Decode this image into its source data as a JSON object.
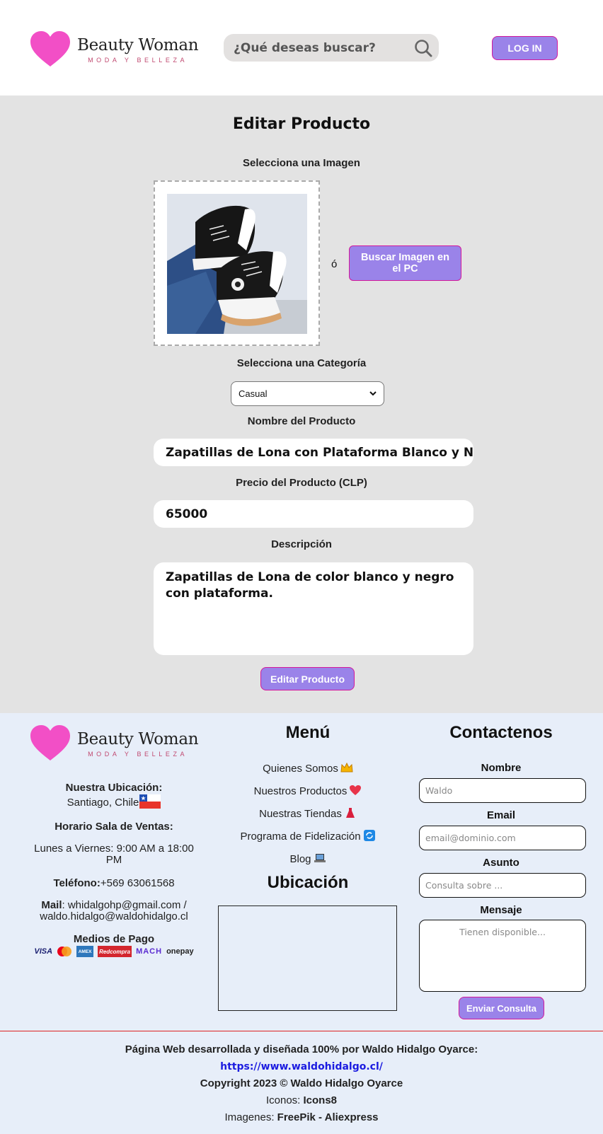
{
  "header": {
    "brand_name": "Beauty Woman",
    "brand_tagline": "MODA Y BELLEZA",
    "search_placeholder": "¿Qué deseas buscar?",
    "login_label": "LOG IN"
  },
  "main": {
    "title": "Editar Producto",
    "image_label": "Selecciona una Imagen",
    "or_text": "ó",
    "browse_label": "Buscar Imagen en el PC",
    "category_label": "Selecciona una Categoría",
    "category_value": "Casual",
    "name_label": "Nombre del Producto",
    "name_value": "Zapatillas de Lona con Plataforma Blanco y Negro",
    "price_label": "Precio del Producto (CLP)",
    "price_value": "65000",
    "description_label": "Descripción",
    "description_value": "Zapatillas de Lona de color blanco y negro con plataforma.",
    "submit_label": "Editar Producto"
  },
  "footer": {
    "brand_name": "Beauty Woman",
    "brand_tagline": "MODA Y BELLEZA",
    "location_title": "Nuestra Ubicación:",
    "location_value": "Santiago, Chile",
    "hours_title": "Horario Sala de Ventas:",
    "hours_value": "Lunes a Viernes: 9:00 AM a 18:00 PM",
    "phone_title": "Teléfono:",
    "phone_value": "+569 63061568",
    "mail_title": "Mail",
    "mail_value": ": whidalgohp@gmail.com / waldo.hidalgo@waldohidalgo.cl",
    "payments_title": "Medios de Pago",
    "payments": [
      "VISA",
      "mastercard",
      "AMEX",
      "Redcompra",
      "MACH",
      "onepay"
    ],
    "menu_title": "Menú",
    "menu_items": [
      "Quienes Somos",
      "Nuestros Productos",
      "Nuestras Tiendas",
      "Programa de Fidelización",
      "Blog"
    ],
    "location_section_title": "Ubicación",
    "contact_title": "Contactenos",
    "contact_name_label": "Nombre",
    "contact_name_placeholder": "Waldo",
    "contact_email_label": "Email",
    "contact_email_placeholder": "email@dominio.com",
    "contact_subject_label": "Asunto",
    "contact_subject_placeholder": "Consulta sobre ...",
    "contact_message_label": "Mensaje",
    "contact_message_placeholder": "Tienen disponible...",
    "send_label": "Enviar Consulta"
  },
  "bottom": {
    "credit_line": "Página Web desarrollada y diseñada 100% por Waldo Hidalgo Oyarce:",
    "credit_url": "https://www.waldohidalgo.cl/",
    "copyright": "Copyright 2023 © Waldo Hidalgo Oyarce",
    "icons_label": "Iconos: ",
    "icons_value": "Icons8",
    "images_label": "Imagenes: ",
    "images_value": "FreePik - Aliexpress"
  },
  "colors": {
    "accent": "#9a83e9",
    "accent_border": "#d3189b",
    "heart": "#f24fc6",
    "main_bg": "#e3e3e3",
    "footer_bg": "#e7eef9"
  }
}
